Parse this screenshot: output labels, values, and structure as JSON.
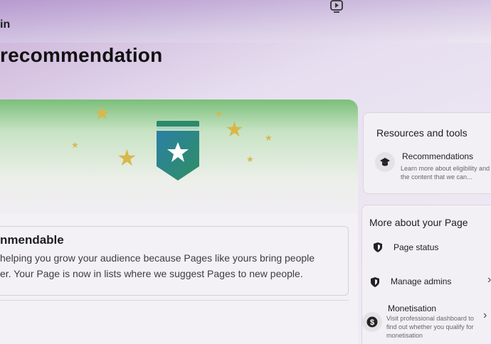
{
  "top": {
    "fragment": "in",
    "video_icon": "play-video-icon"
  },
  "page": {
    "title": "recommendation"
  },
  "status": {
    "title": "nmendable",
    "line1": "helping you grow your audience because Pages like yours bring people",
    "line2": "er. Your Page is now in lists where we suggest Pages to new people."
  },
  "resources": {
    "heading": "Resources and tools",
    "item": {
      "title": "Recommendations",
      "desc": "Learn more about eligibility and the content that we can...",
      "icon": "graduation-cap-icon"
    }
  },
  "more": {
    "heading": "More about your Page",
    "items": [
      {
        "title": "Page status",
        "icon": "shield-icon"
      },
      {
        "title": "Manage admins",
        "icon": "shield-icon"
      },
      {
        "title": "Monetisation",
        "desc": "Visit professional dashboard to find out whether you qualify for monetisation",
        "icon": "dollar-icon"
      }
    ]
  },
  "colors": {
    "accent_green": "#2a8a6a",
    "star_gold": "#d8b84a"
  }
}
